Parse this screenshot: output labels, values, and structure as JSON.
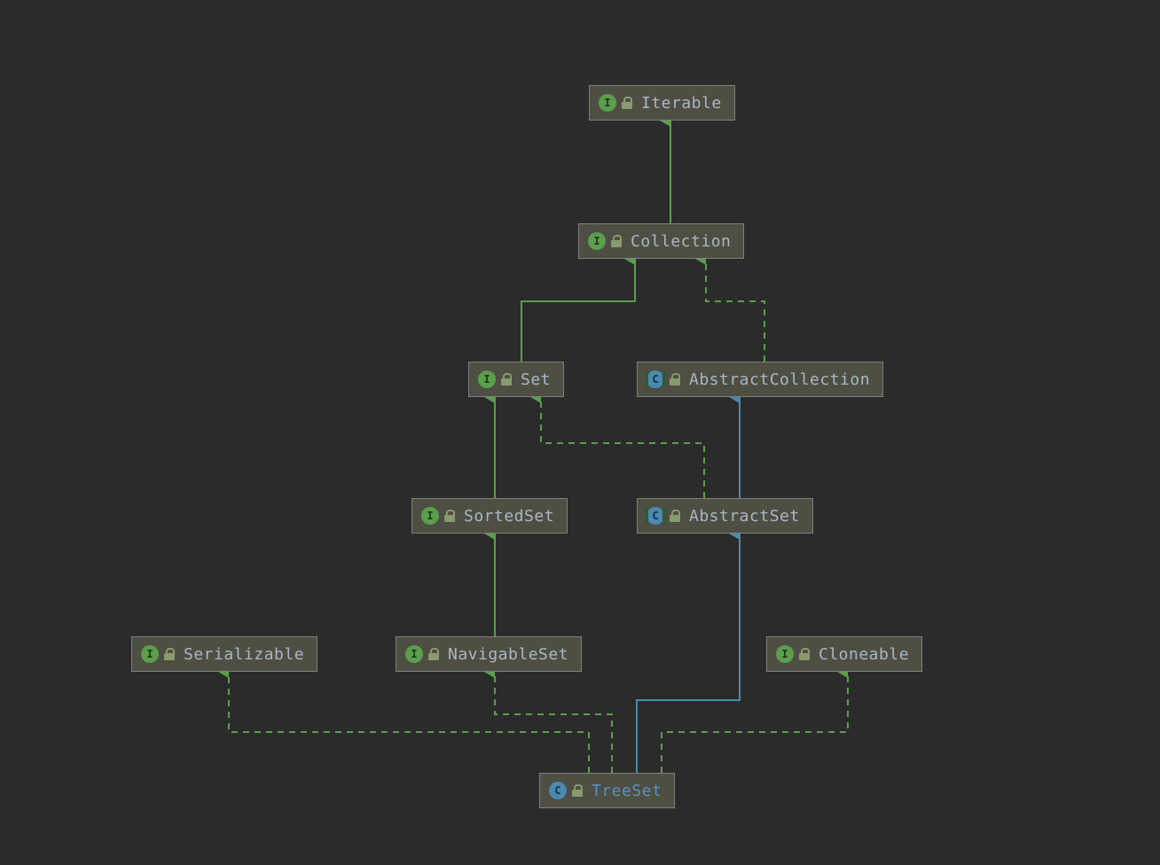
{
  "colors": {
    "bg": "#2b2b2b",
    "node_bg": "#4e4e42",
    "node_border": "#808080",
    "interface_badge": "#5b9e4d",
    "class_badge": "#4a8ab0",
    "edge_green": "#5b9e4d",
    "edge_blue": "#4a8ab0",
    "text_default": "#a9b7c6",
    "text_class": "#5394c4"
  },
  "nodes": {
    "iterable": {
      "kind": "interface",
      "badge": "I",
      "label": "Iterable"
    },
    "collection": {
      "kind": "interface",
      "badge": "I",
      "label": "Collection"
    },
    "set": {
      "kind": "interface",
      "badge": "I",
      "label": "Set"
    },
    "abstractcollection": {
      "kind": "abstract",
      "badge": "C",
      "label": "AbstractCollection"
    },
    "sortedset": {
      "kind": "interface",
      "badge": "I",
      "label": "SortedSet"
    },
    "abstractset": {
      "kind": "abstract",
      "badge": "C",
      "label": "AbstractSet"
    },
    "serializable": {
      "kind": "interface",
      "badge": "I",
      "label": "Serializable"
    },
    "navigableset": {
      "kind": "interface",
      "badge": "I",
      "label": "NavigableSet"
    },
    "cloneable": {
      "kind": "interface",
      "badge": "I",
      "label": "Cloneable"
    },
    "treeset": {
      "kind": "class",
      "badge": "C",
      "label": "TreeSet"
    }
  },
  "edges": [
    {
      "from": "collection",
      "to": "iterable",
      "style": "solid",
      "color": "green"
    },
    {
      "from": "set",
      "to": "collection",
      "style": "solid",
      "color": "green"
    },
    {
      "from": "abstractcollection",
      "to": "collection",
      "style": "dashed",
      "color": "green"
    },
    {
      "from": "sortedset",
      "to": "set",
      "style": "solid",
      "color": "green"
    },
    {
      "from": "abstractset",
      "to": "set",
      "style": "dashed",
      "color": "green"
    },
    {
      "from": "abstractset",
      "to": "abstractcollection",
      "style": "solid",
      "color": "blue"
    },
    {
      "from": "navigableset",
      "to": "sortedset",
      "style": "solid",
      "color": "green"
    },
    {
      "from": "treeset",
      "to": "serializable",
      "style": "dashed",
      "color": "green"
    },
    {
      "from": "treeset",
      "to": "navigableset",
      "style": "dashed",
      "color": "green"
    },
    {
      "from": "treeset",
      "to": "abstractset",
      "style": "solid",
      "color": "blue"
    },
    {
      "from": "treeset",
      "to": "cloneable",
      "style": "dashed",
      "color": "green"
    }
  ]
}
